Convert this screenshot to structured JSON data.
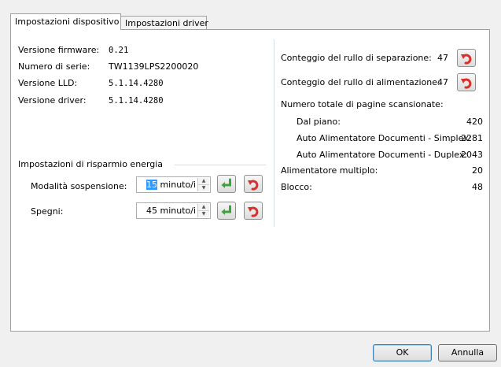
{
  "tabs": [
    {
      "label": "Impostazioni dispositivo"
    },
    {
      "label": "Impostazioni driver"
    }
  ],
  "info": {
    "firmware_label": "Versione firmware:",
    "firmware_value": "0.21",
    "serial_label": "Numero di serie:",
    "serial_value": "TW1139LPS2200020",
    "lld_label": "Versione LLD:",
    "lld_value": "5.1.14.4280",
    "driver_label": "Versione driver:",
    "driver_value": "5.1.14.4280"
  },
  "power": {
    "group_title": "Impostazioni di risparmio energia",
    "sleep_label": "Modalità sospensione:",
    "sleep_value_num": "15",
    "sleep_value_unit": " minuto/i",
    "off_label": "Spegni:",
    "off_value": "45 minuto/i"
  },
  "counters": {
    "separation_label": "Conteggio del rullo di separazione:",
    "separation_value": "47",
    "feed_label": "Conteggio del rullo di alimentazione:",
    "feed_value": "47",
    "total_label": "Numero totale di pagine scansionate:",
    "flatbed_label": "Dal piano:",
    "flatbed_value": "420",
    "simplex_label": "Auto Alimentatore Documenti - Simplex:",
    "simplex_value": "2281",
    "duplex_label": "Auto Alimentatore Documenti - Duplex:",
    "duplex_value": "2043",
    "multifeed_label": "Alimentatore multiplo:",
    "multifeed_value": "20",
    "jam_label": "Blocco:",
    "jam_value": "48"
  },
  "footer": {
    "ok_label": "OK",
    "cancel_label": "Annulla"
  },
  "icons": {
    "reset": "reset-arrow-icon",
    "apply": "green-enter-arrow-icon"
  },
  "colors": {
    "reset_arrow": "#d9302c",
    "apply_arrow": "#3aa33a",
    "selection": "#3399ff"
  }
}
